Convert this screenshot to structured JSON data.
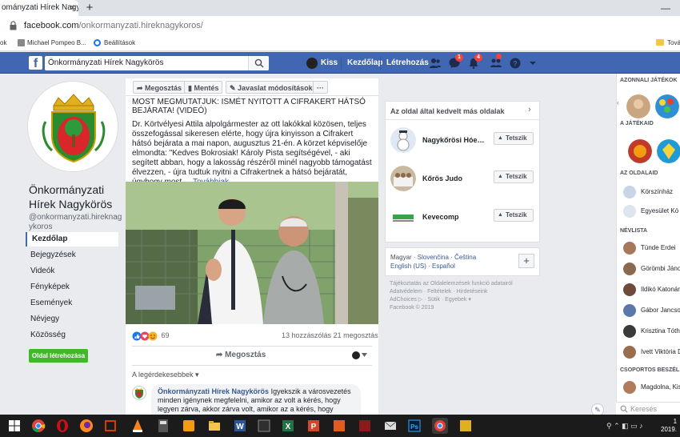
{
  "browser": {
    "tab_title": "ományzati Hírek Nagykörös",
    "tab_close": "×",
    "new_tab": "+",
    "window_min": "—",
    "back": "ook",
    "url_host": "facebook.com",
    "url_path": "/onkormanyzati.hireknagykoros/",
    "bookmarks": [
      "ok",
      "Michael Pompeo B...",
      "Beállítások"
    ],
    "bookmark_right": "Tová"
  },
  "fb_bar": {
    "logo": "f",
    "search_value": "Önkormányzati Hírek Nagykörös",
    "user_name": "Kiss",
    "home": "Kezdőlap",
    "create": "Létrehozás",
    "badges": {
      "messages": "1",
      "notifications": "4"
    },
    "brand_color": "#4267b2"
  },
  "left": {
    "page_name": "Önkormányzati Hírek Nagykörös",
    "handle": "@onkormanyzati.hireknagykoros",
    "nav": [
      "Kezdőlap",
      "Bejegyzések",
      "Videók",
      "Fényképek",
      "Események",
      "Névjegy",
      "Közösség"
    ],
    "active_nav": "Kezdőlap",
    "create_page": "Oldal létrehozása"
  },
  "actions": {
    "share": "Megosztás",
    "save": "Mentés",
    "suggest": "Javaslat módosításokra",
    "more": "···"
  },
  "post": {
    "title": "MOST MEGMUTATJUK: ISMÉT NYITOTT A CIFRAKERT HÁTSÓ BEJÁRATA! (VIDEÓ)",
    "text": "Dr. Körtvélyesi Attila alpolgármester az ott lakókkal közösen, teljes összefogással sikeresen elérte, hogy újra kinyisson a Cifrakert hátsó bejárata a mai napon, augusztus 21-én. A körzet képviselője elmondta: \"Kedves Bokrosiak! Károly Pista segítségével, - aki segített abban, hogy a lakosság részéről minél nagyobb támogatást élvezzen, - újra tudtuk nyitni a Cifrakertnek a hátsó bejáratát, úgyhogy most ...",
    "read_more": "Továbbiak",
    "reaction_count": "69",
    "comments": "13 hozzászólás",
    "shares": "21 megosztás",
    "share_button": "Megosztás",
    "relevant": "A legérdekesebbek ▾",
    "comment_author": "Önkormányzati Hírek Nagykörös",
    "comment_text": "Igyekszik a városvezetés minden igénynek megfelelni, amikor az volt a kérés, hogy legyen zárva, akkor zárva volt, amikor az a kérés, hogy legyen nyitva, nyitva van. Másik esetben, nem itt, padok kerültek kihelyezésre, mert az volt az..."
  },
  "liked": {
    "title": "Az oldal által kedvelt más oldalak",
    "chevron": "›",
    "like_label": "Tetszik",
    "items": [
      "Nagykőrösi Hóemb...",
      "Kőrös Judo",
      "Kevecomp"
    ]
  },
  "langs": {
    "current": "Magyar",
    "others": [
      "Slovenčina",
      "Čeština",
      "English (US)",
      "Español"
    ],
    "plus": "+"
  },
  "footer": {
    "lines": [
      "Tájékoztatás az Oldalelemzések funkció adatairól",
      "Adatvédelem · Feltételek · Hirdetéseink",
      "AdChoices ▷ · Sütik · Egyebek ▾",
      "Facebook © 2019"
    ]
  },
  "chat": {
    "games_header": "AZONNALI JÁTÉKOK",
    "games_sub": "A JÁTÉKAID",
    "pages_header": "AZ OLDALAID",
    "pages": [
      "Körszínház",
      "Egyesület Kö"
    ],
    "contacts_header": "NÉVLISTA",
    "contacts": [
      "Tünde Erdei",
      "Görömbi Jáno",
      "Ildikó Katonán",
      "Gábor Jancsov",
      "Krisztina Tóth",
      "Ivett Viktória D"
    ],
    "groups_header": "CSOPORTOS BESZÉL",
    "groups": [
      "Magdolna, Kis"
    ],
    "search_placeholder": "Keresés"
  },
  "taskbar": {
    "time": "1",
    "date": "2019."
  }
}
